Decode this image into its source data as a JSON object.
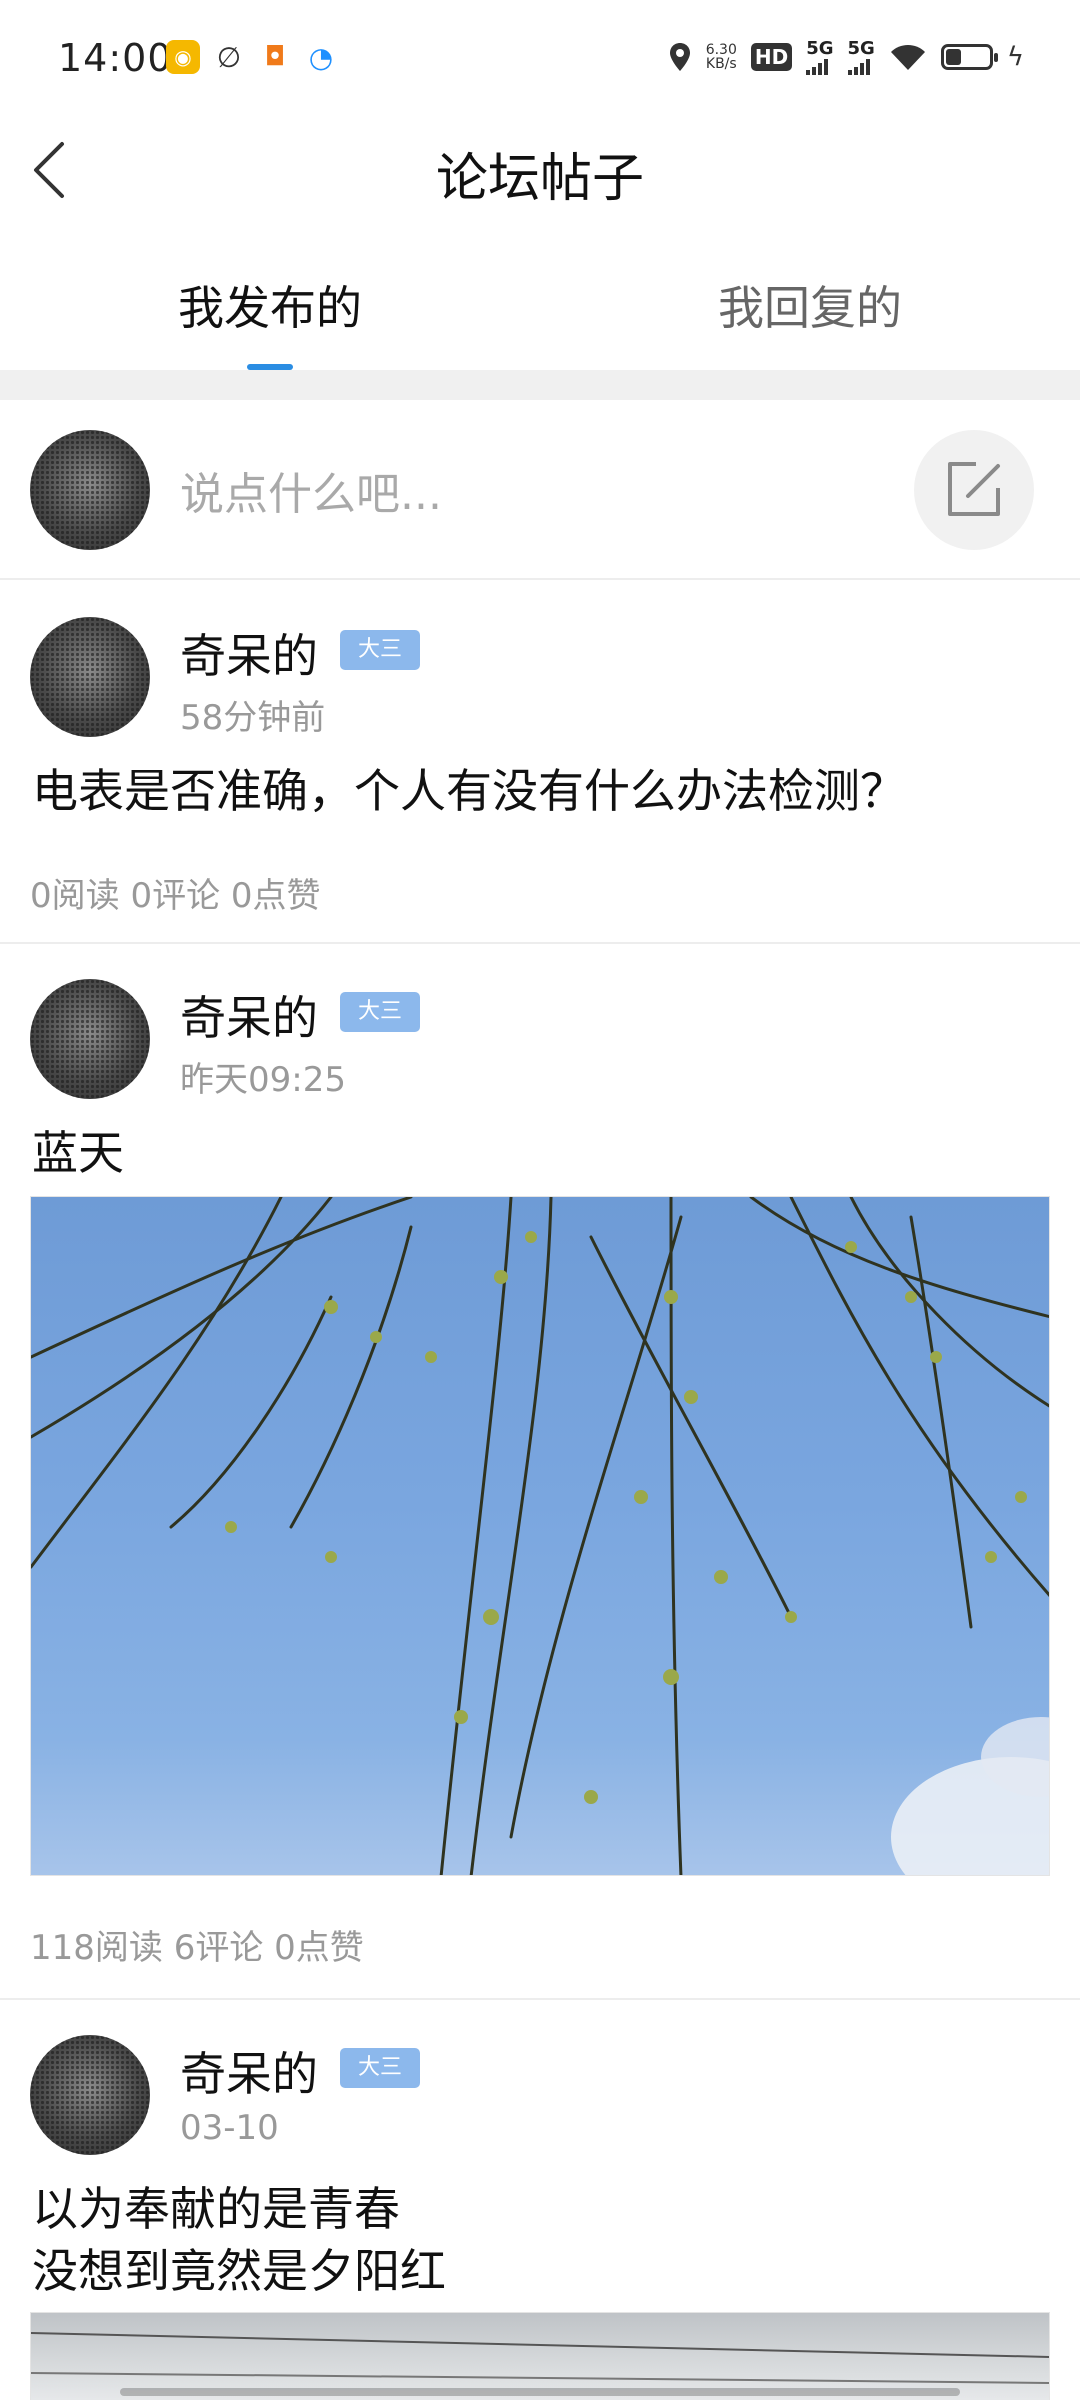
{
  "status_bar": {
    "time": "14:00",
    "net_speed_value": "6.30",
    "net_speed_unit": "KB/s",
    "hd_label": "HD",
    "sim1_label": "5G",
    "sim2_label": "5G",
    "battery_level_fraction": 0.25
  },
  "header": {
    "title": "论坛帖子"
  },
  "tabs": [
    {
      "label": "我发布的",
      "active": true
    },
    {
      "label": "我回复的",
      "active": false
    }
  ],
  "composer": {
    "placeholder": "说点什么吧..."
  },
  "posts": [
    {
      "author": "奇呆的",
      "grade": "大三",
      "time": "58分钟前",
      "content": "电表是否准确，个人有没有什么办法检测？",
      "stats": "0阅读 0评论 0点赞"
    },
    {
      "author": "奇呆的",
      "grade": "大三",
      "time": "昨天09:25",
      "content": "蓝天",
      "stats": "118阅读 6评论 0点赞"
    },
    {
      "author": "奇呆的",
      "grade": "大三",
      "time": "03-10",
      "content": "以为奉献的是青春\n没想到竟然是夕阳红"
    }
  ],
  "colors": {
    "accent": "#2a8de3",
    "badge": "#8cb8ec",
    "muted_text": "#999999"
  }
}
